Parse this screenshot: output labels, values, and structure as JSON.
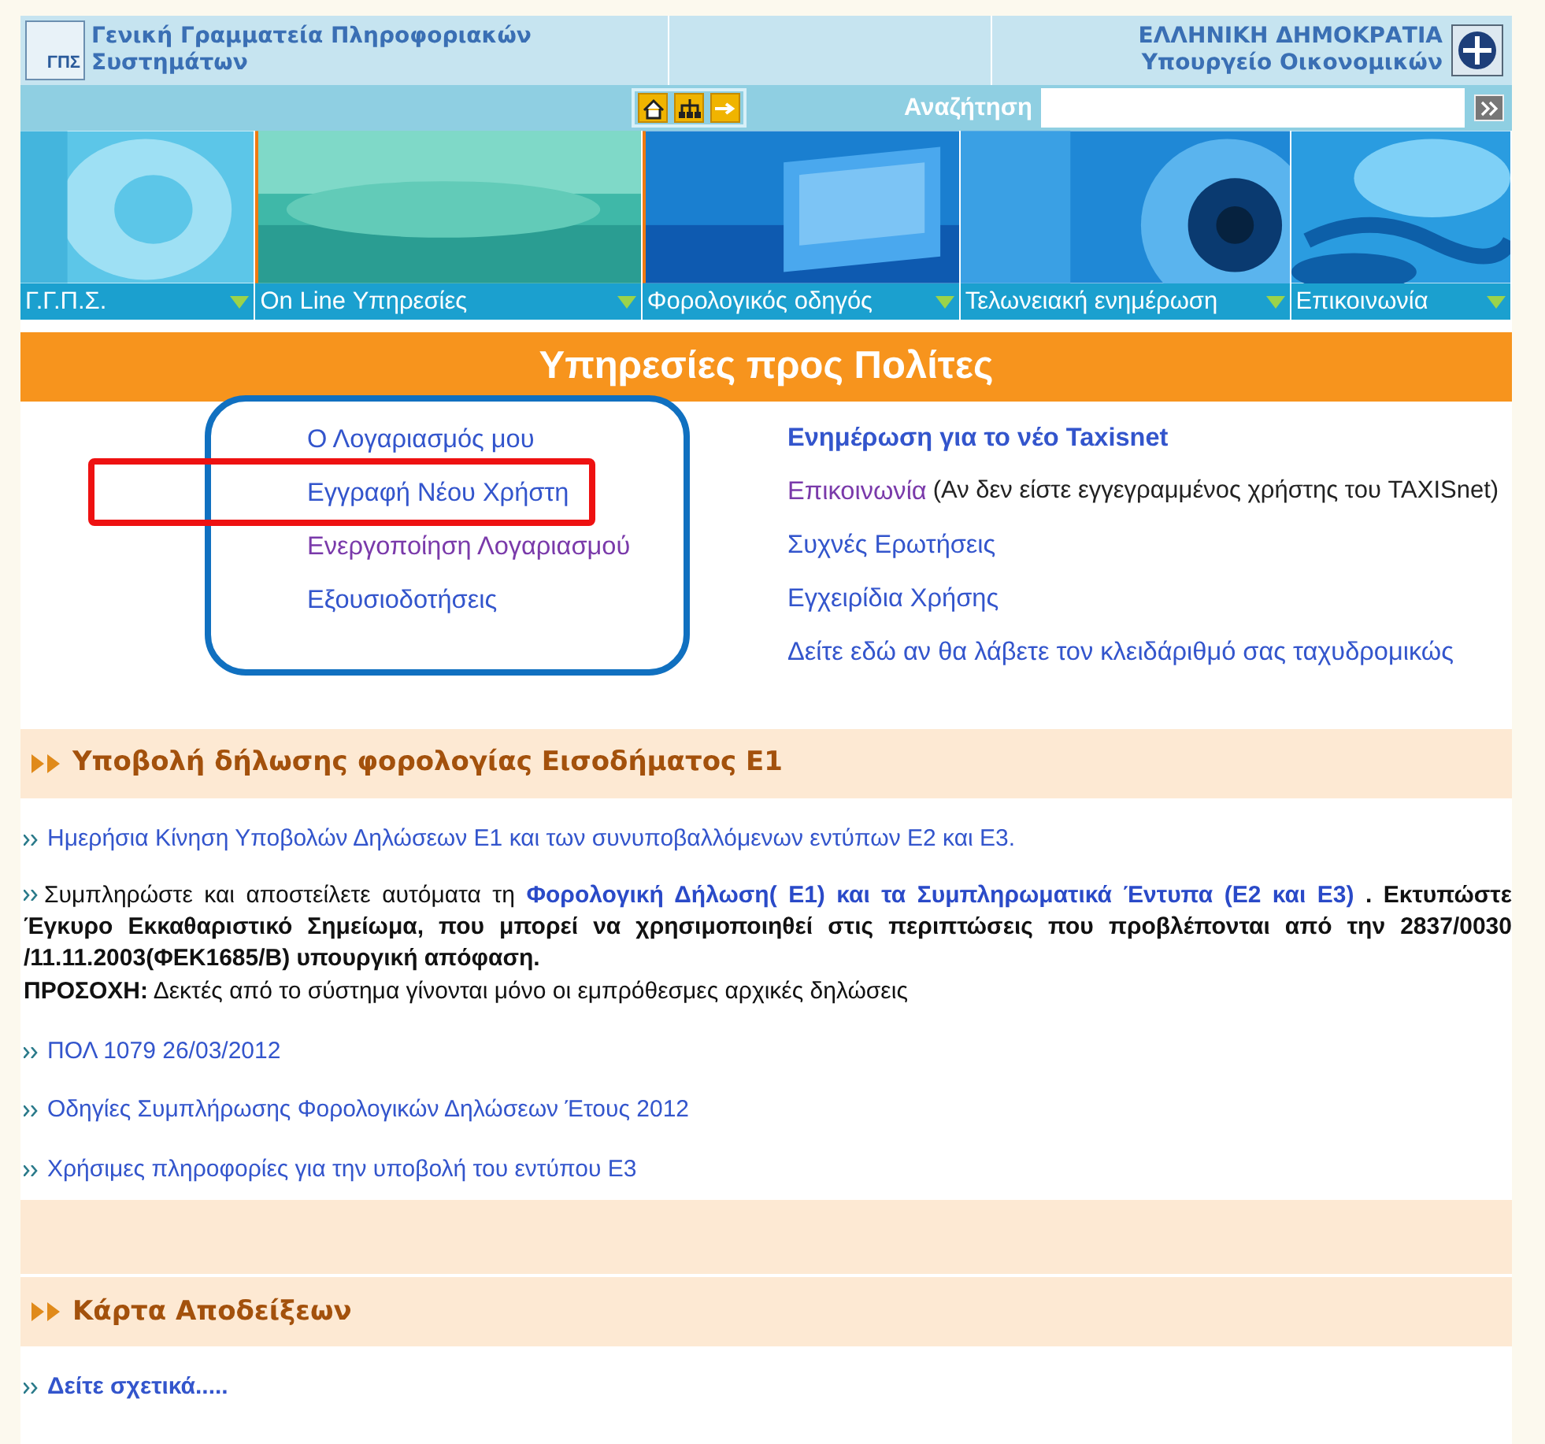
{
  "header": {
    "logo_text": "ΓΠΣ",
    "org_lines": [
      "Γενική Γραμματεία Πληροφοριακών",
      "Συστημάτων"
    ],
    "state_lines": [
      "ΕΛΛΗΝΙΚΗ ΔΗΜΟΚΡΑΤΙΑ",
      "Υπουργείο Οικονομικών"
    ]
  },
  "toolbar": {
    "search_label": "Αναζήτηση"
  },
  "menu": [
    {
      "label": "Γ.Γ.Π.Σ."
    },
    {
      "label": "On Line Υπηρεσίες"
    },
    {
      "label": "Φορολογικός οδηγός"
    },
    {
      "label": "Τελωνειακή ενημέρωση"
    },
    {
      "label": "Επικοινωνία"
    }
  ],
  "services": {
    "title": "Υπηρεσίες προς Πολίτες",
    "left_outlined": true,
    "left_links": [
      {
        "text": "Ο Λογαριασμός μου",
        "visited": false,
        "highlighted": false
      },
      {
        "text": "Εγγραφή Νέου Χρήστη",
        "visited": false,
        "highlighted": true
      },
      {
        "text": "Ενεργοποίηση Λογαριασμού",
        "visited": true,
        "highlighted": false
      },
      {
        "text": "Εξουσιοδοτήσεις",
        "visited": false,
        "highlighted": false
      }
    ],
    "right_links": [
      {
        "text": "Ενημέρωση για το νέο Taxisnet",
        "visited": false,
        "bold": true
      },
      {
        "text": "Επικοινωνία",
        "visited": true,
        "bold": false,
        "note": "(Αν δεν είστε εγγεγραμμένος χρήστης του TAXISnet)"
      },
      {
        "text": "Συχνές Ερωτήσεις",
        "visited": false,
        "bold": false
      },
      {
        "text": "Εγχειρίδια Χρήσης",
        "visited": false,
        "bold": false
      },
      {
        "text": "Δείτε εδώ αν θα λάβετε τον κλειδάριθμό σας ταχυδρομικώς",
        "visited": false,
        "bold": false
      }
    ]
  },
  "sections": [
    {
      "title": "Υποβολή δήλωσης φορολογίας Εισοδήματος Ε1",
      "items": [
        {
          "kind": "link",
          "text": "Ημερήσια Κίνηση Υποβολών Δηλώσεων Ε1 και των συνυποβαλλόμενων εντύπων Ε2 και Ε3."
        },
        {
          "kind": "paragraph",
          "before": "Συμπληρώστε και αποστείλετε αυτόματα τη ",
          "link": "Φορολογική Δήλωση( Ε1) και τα Συμπληρωματικά Έντυπα (Ε2 και Ε3)",
          "after": " **. Εκτυπώστε Έγκυρο Εκκαθαριστικό Σημείωμα, που μπορεί να χρησιμοποιηθεί στις περιπτώσεις που προβλέπονται από την 2837/0030 /11.11.2003(ΦΕΚ1685/Β) υπουργική απόφαση.**",
          "note": "**ΠΡΟΣΟΧΗ:** Δεκτές από το σύστημα γίνονται μόνο οι εμπρόθεσμες αρχικές δηλώσεις"
        },
        {
          "kind": "link",
          "text": "ΠΟΛ 1079 26/03/2012"
        },
        {
          "kind": "link",
          "text": "Οδηγίες Συμπλήρωσης Φορολογικών Δηλώσεων Έτους 2012"
        },
        {
          "kind": "link",
          "text": "Χρήσιμες πληροφορίες για την υποβολή του εντύπου Ε3"
        }
      ]
    },
    {
      "kind": "blank"
    },
    {
      "title": "Κάρτα Αποδείξεων",
      "items": [
        {
          "kind": "bold_link",
          "text": "Δείτε σχετικά....."
        }
      ]
    }
  ]
}
